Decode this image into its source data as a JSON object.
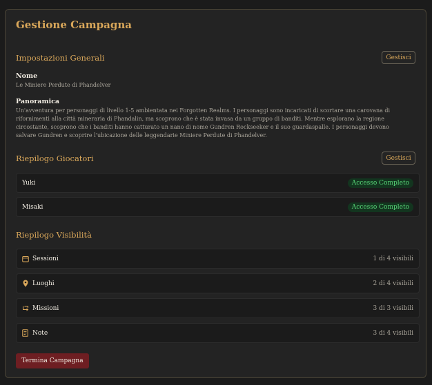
{
  "page": {
    "title": "Gestione Campagna"
  },
  "general": {
    "heading": "Impostazioni Generali",
    "manage_label": "Gestisci",
    "name_label": "Nome",
    "name_value": "Le Miniere Perdute di Phandelver",
    "overview_label": "Panoramica",
    "overview_value": "Un'avventura per personaggi di livello 1-5 ambientata nei Forgotten Realms. I personaggi sono incaricati di scortare una carovana di rifornimenti alla città mineraria di Phandalin, ma scoprono che è stata invasa da un gruppo di banditi. Mentre esplorano la regione circostante, scoprono che i banditi hanno catturato un nano di nome Gundren Rockseeker e il suo guardaspalle. I personaggi devono salvare Gundren e scoprire l'ubicazione delle leggendarie Miniere Perdute di Phandelver."
  },
  "players": {
    "heading": "Riepilogo Giocatori",
    "manage_label": "Gestisci",
    "items": [
      {
        "name": "Yuki",
        "access": "Accesso Completo"
      },
      {
        "name": "Misaki",
        "access": "Accesso Completo"
      }
    ]
  },
  "visibility": {
    "heading": "Riepilogo Visibilità",
    "items": [
      {
        "label": "Sessioni",
        "count": "1 di 4 visibili",
        "icon": "calendar-icon"
      },
      {
        "label": "Luoghi",
        "count": "2 di 4 visibili",
        "icon": "map-pin-icon"
      },
      {
        "label": "Missioni",
        "count": "3 di 3 visibili",
        "icon": "quest-icon"
      },
      {
        "label": "Note",
        "count": "3 di 4 visibili",
        "icon": "note-icon"
      }
    ]
  },
  "actions": {
    "end_campaign_label": "Termina Campagna"
  },
  "colors": {
    "accent": "#d9a75a",
    "success": "#58d678",
    "danger": "#6e1e22"
  }
}
